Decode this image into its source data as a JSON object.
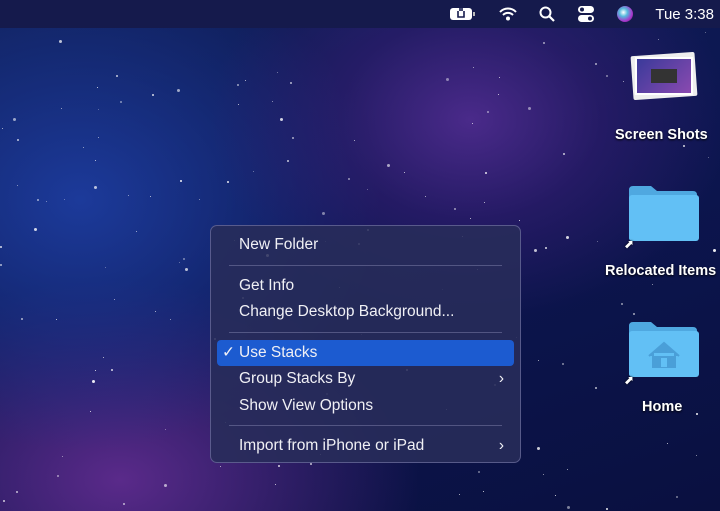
{
  "menubar": {
    "battery_icon": "battery-charging-icon",
    "wifi_icon": "wifi-icon",
    "search_icon": "spotlight-search-icon",
    "control_center_icon": "control-center-icon",
    "siri_icon": "siri-icon",
    "clock": "Tue 3:38"
  },
  "context_menu": {
    "items": [
      {
        "label": "New Folder"
      },
      {
        "label": "Get Info"
      },
      {
        "label": "Change Desktop Background..."
      },
      {
        "label": "Use Stacks",
        "checked": true,
        "check": "✓"
      },
      {
        "label": "Group Stacks By",
        "submenu": "›"
      },
      {
        "label": "Show View Options"
      },
      {
        "label": "Import from iPhone or iPad",
        "submenu": "›"
      }
    ]
  },
  "desktop": {
    "icons": [
      {
        "label": "Screen Shots"
      },
      {
        "label": "Relocated Items"
      },
      {
        "label": "Home"
      }
    ]
  },
  "colors": {
    "highlight": "#1c5bd0",
    "folder": "#5bbcf0"
  }
}
